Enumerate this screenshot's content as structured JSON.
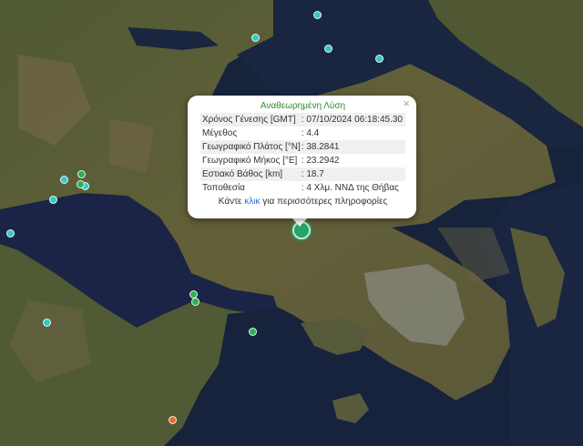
{
  "popup": {
    "title": "Αναθεωρημένη Λύση",
    "close": "×",
    "rows": [
      {
        "label": "Χρόνος Γένεσης [GMT]",
        "value": ": 07/10/2024 06:18:45.30"
      },
      {
        "label": "Μέγεθος",
        "value": ": 4.4"
      },
      {
        "label": "Γεωγραφικό Πλάτος [°N]",
        "value": ": 38.2841"
      },
      {
        "label": "Γεωγραφικό Μήκος [°E]",
        "value": ": 23.2942"
      },
      {
        "label": "Εστιακό Βάθος [km]",
        "value": ": 18.7"
      },
      {
        "label": "Τοποθεσία",
        "value": ": 4 Χλμ. ΝΝΔ της Θήβας"
      }
    ],
    "more_prefix": "Κάντε ",
    "more_link": "κλικ",
    "more_suffix": " για περισσότερες πληροφορίες"
  },
  "marker_colors": {
    "cyan": "#35c8c8",
    "green": "#2fae5a",
    "orange": "#e2702b",
    "highlight": "#24a36a"
  },
  "map_colors": {
    "sea": "#16223a",
    "gulf": "#1b2345",
    "land": "#5b5d3a",
    "mountain": "#7a6a4a",
    "urban": "#8c8c84"
  }
}
